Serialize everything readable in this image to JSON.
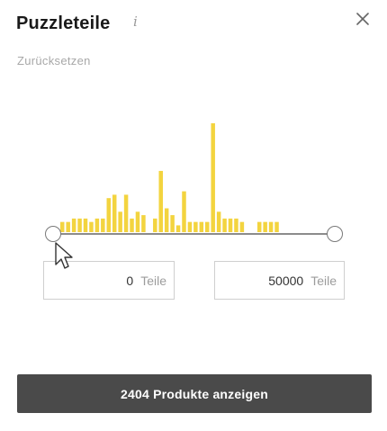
{
  "header": {
    "title": "Puzzleteile",
    "info_icon": "info-icon",
    "close_icon": "close-icon"
  },
  "reset_label": "Zurücksetzen",
  "range": {
    "min_value": "0",
    "max_value": "50000",
    "unit": "Teile"
  },
  "histogram": {
    "bar_color": "#f3d43f",
    "values": [
      3,
      3,
      4,
      4,
      4,
      3,
      4,
      4,
      10,
      11,
      6,
      11,
      4,
      6,
      5,
      0,
      4,
      18,
      7,
      5,
      2,
      12,
      3,
      3,
      3,
      3,
      32,
      6,
      4,
      4,
      4,
      3,
      0,
      0,
      3,
      3,
      3,
      3
    ]
  },
  "submit_button": {
    "label": "2404 Produkte anzeigen",
    "color": "#4a4a4a"
  },
  "colors": {
    "accent": "#f3d43f",
    "muted_text": "#a8a8a8"
  }
}
